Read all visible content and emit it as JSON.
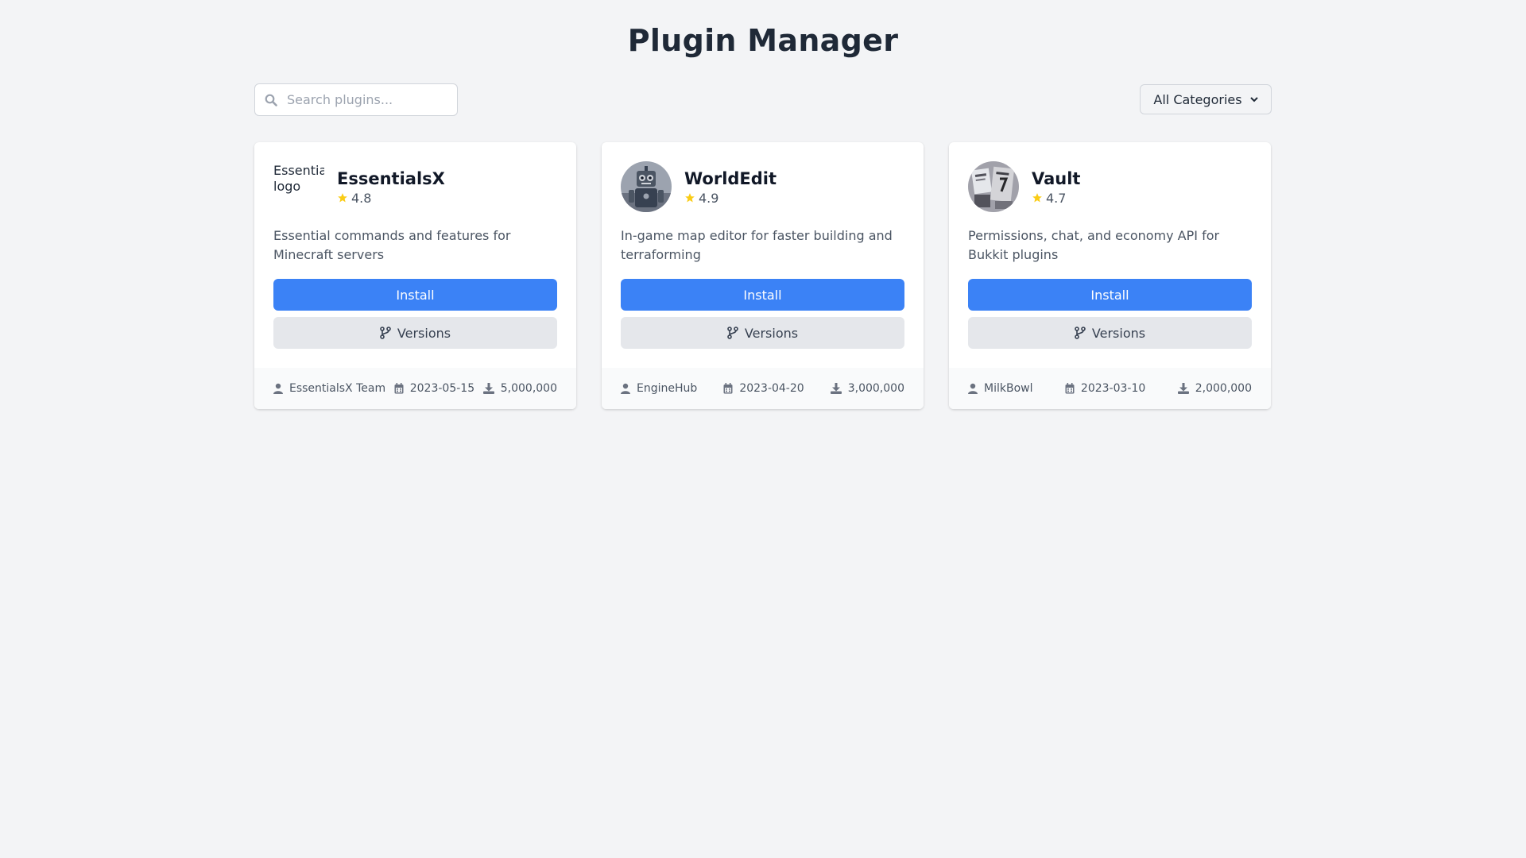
{
  "header": {
    "title": "Plugin Manager"
  },
  "search": {
    "placeholder": "Search plugins...",
    "value": ""
  },
  "category_filter": {
    "selected": "All Categories"
  },
  "actions": {
    "install_label": "Install",
    "versions_label": "Versions"
  },
  "icons": {
    "search": "search-icon",
    "star": "star-icon",
    "versions": "code-branch-icon",
    "author": "user-icon",
    "date": "calendar-icon",
    "downloads": "download-icon",
    "select": "chevron-down-icon"
  },
  "colors": {
    "accent": "#3b82f6",
    "star": "#facc15",
    "background": "#f3f4f6"
  },
  "plugins": [
    {
      "name": "EssentialsX",
      "logo_alt": "EssentialsX logo",
      "logo_broken": true,
      "rating": "4.8",
      "description": "Essential commands and features for Minecraft servers",
      "author": "EssentialsX Team",
      "date": "2023-05-15",
      "downloads": "5,000,000"
    },
    {
      "name": "WorldEdit",
      "logo_alt": "WorldEdit logo",
      "logo_broken": false,
      "rating": "4.9",
      "description": "In-game map editor for faster building and terraforming",
      "author": "EngineHub",
      "date": "2023-04-20",
      "downloads": "3,000,000"
    },
    {
      "name": "Vault",
      "logo_alt": "Vault logo",
      "logo_broken": false,
      "rating": "4.7",
      "description": "Permissions, chat, and economy API for Bukkit plugins",
      "author": "MilkBowl",
      "date": "2023-03-10",
      "downloads": "2,000,000"
    }
  ]
}
